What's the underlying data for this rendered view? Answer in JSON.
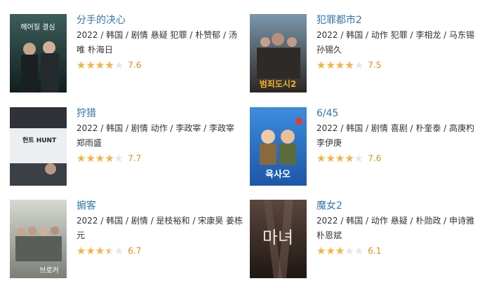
{
  "movies": [
    {
      "title": "分手的决心",
      "meta": "2022 / 韩国 / 剧情 悬疑 犯罪 / 朴赞郁 / 汤唯 朴海日",
      "score": "7.6",
      "rating_fraction": 0.8,
      "poster_text": "헤어질 결심",
      "poster_colors": [
        "#2f4b48",
        "#0f1e1f"
      ]
    },
    {
      "title": "犯罪都市2",
      "meta": "2022 / 韩国 / 动作 犯罪 / 李相龙 / 马东锡 孙锡久",
      "score": "7.5",
      "rating_fraction": 0.8,
      "poster_text": "범죄도시2",
      "poster_colors": [
        "#6b8aa3",
        "#2b2623"
      ]
    },
    {
      "title": "狩猎",
      "meta": "2022 / 韩国 / 剧情 动作 / 李政宰 / 李政宰 郑雨盛",
      "score": "7.7",
      "rating_fraction": 0.8,
      "poster_text": "헌트 HUNT",
      "poster_colors": [
        "#e8eaec",
        "#3b3f46"
      ]
    },
    {
      "title": "6/45",
      "meta": "2022 / 韩国 / 剧情 喜剧 / 朴奎泰 / 高庚杓 李伊庚",
      "score": "7.6",
      "rating_fraction": 0.8,
      "poster_text": "육사오",
      "poster_colors": [
        "#2f7fd6",
        "#1d56a8"
      ]
    },
    {
      "title": "掮客",
      "meta": "2022 / 韩国 / 剧情 / 是枝裕和 / 宋康昊 姜栋元",
      "score": "6.7",
      "rating_fraction": 0.7,
      "poster_text": "브로커",
      "poster_colors": [
        "#c9ccc4",
        "#7b7f78"
      ]
    },
    {
      "title": "魔女2",
      "meta": "2022 / 韩国 / 动作 悬疑 / 朴勋政 / 申诗雅 朴恩斌",
      "score": "6.1",
      "rating_fraction": 0.6,
      "poster_text": "마녀",
      "poster_colors": [
        "#4a3a33",
        "#1e1714"
      ]
    }
  ],
  "star_glyph": "★★★★★",
  "colors": {
    "title": "#3377aa",
    "star_filled": "#f6b33d",
    "star_empty": "#e6e6e6",
    "score": "#e09015"
  }
}
